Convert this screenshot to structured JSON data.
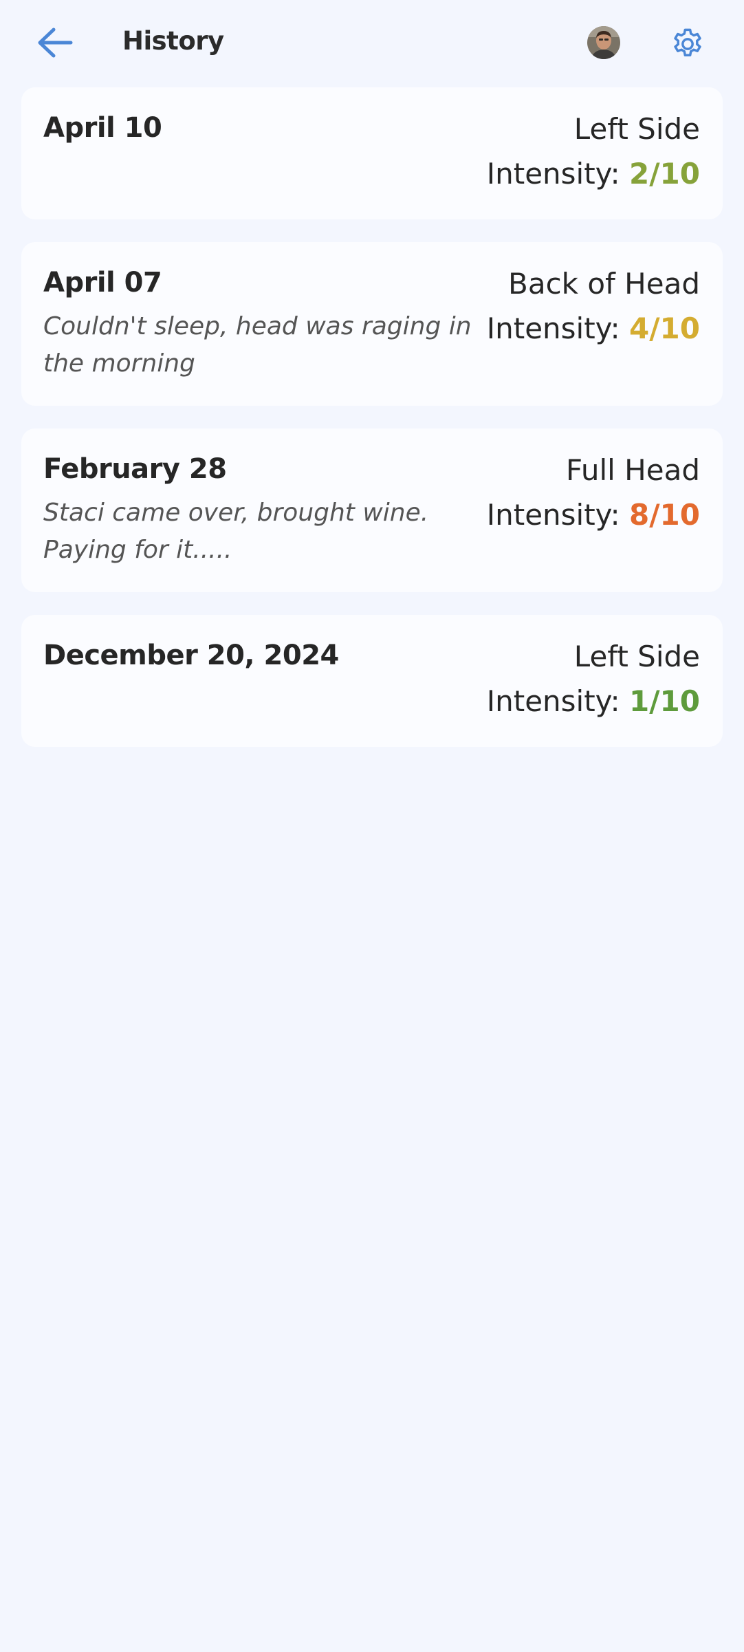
{
  "header": {
    "title": "History",
    "accent_color": "#4a86d6",
    "back_icon": "arrow-left-icon",
    "settings_icon": "gear-icon"
  },
  "entries": [
    {
      "date": "April 10",
      "note": "",
      "location": "Left Side",
      "intensity_label": "Intensity:",
      "intensity_value": "2/10",
      "intensity_color": "#86a23a"
    },
    {
      "date": "April 07",
      "note": "Couldn't sleep, head was raging in the morning",
      "location": "Back of Head",
      "intensity_label": "Intensity:",
      "intensity_value": "4/10",
      "intensity_color": "#d4ac31"
    },
    {
      "date": "February 28",
      "note": "Staci came over, brought wine. Paying for it.....",
      "location": "Full Head",
      "intensity_label": "Intensity:",
      "intensity_value": "8/10",
      "intensity_color": "#e36a2e"
    },
    {
      "date": "December 20, 2024",
      "note": "",
      "location": "Left Side",
      "intensity_label": "Intensity:",
      "intensity_value": "1/10",
      "intensity_color": "#5e9b3c"
    }
  ]
}
